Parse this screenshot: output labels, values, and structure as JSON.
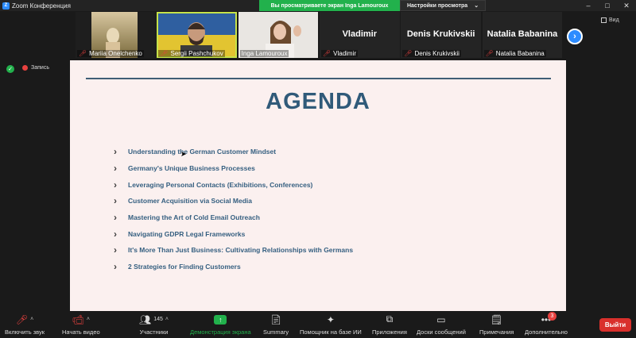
{
  "window": {
    "title": "Zoom Конференция",
    "share_banner": "Вы просматриваете экран Inga Lamouroux",
    "view_options": "Настройки просмотра",
    "controls": [
      "–",
      "□",
      "✕"
    ]
  },
  "participants": [
    {
      "name": "Mariia Onelchenko",
      "muted": true,
      "video": true
    },
    {
      "name": "Sergii Pashchukov",
      "muted": true,
      "video": true,
      "active": true
    },
    {
      "name": "Inga Lamouroux",
      "muted": false,
      "video": true
    },
    {
      "name": "Vladimir",
      "display": "Vladimir",
      "muted": true,
      "video": false
    },
    {
      "name": "Denis Krukivskii",
      "display": "Denis Krukivskii",
      "muted": true,
      "video": false
    },
    {
      "name": "Natalia Babanina",
      "display": "Natalia Babanina",
      "muted": true,
      "video": false
    }
  ],
  "view_button": "Вид",
  "recording": "Запись",
  "slide": {
    "title": "AGENDA",
    "items": [
      "Understanding the German Customer Mindset",
      "Germany's Unique Business Processes",
      "Leveraging Personal Contacts (Exhibitions, Conferences)",
      "Customer Acquisition via Social Media",
      "Mastering the Art of Cold Email Outreach",
      "Navigating GDPR Legal Frameworks",
      "It's More Than Just Business: Cultivating Relationships with Germans",
      "2 Strategies for Finding Customers"
    ]
  },
  "toolbar": {
    "audio": "Включить звук",
    "video": "Начать видео",
    "participants": "Участники",
    "participants_count": "145",
    "share": "Демонстрация экрана",
    "summary": "Summary",
    "ai": "Помощник на базе ИИ",
    "apps": "Приложения",
    "whiteboards": "Доски сообщений",
    "notes": "Примечания",
    "more": "Дополнительно",
    "more_badge": "3",
    "leave": "Выйти"
  },
  "colors": {
    "share_green": "#22b14c",
    "slide_title": "#305a79",
    "slide_bg": "#fbf0ef",
    "leave_red": "#d9302c",
    "zoom_blue": "#2d8cff"
  }
}
